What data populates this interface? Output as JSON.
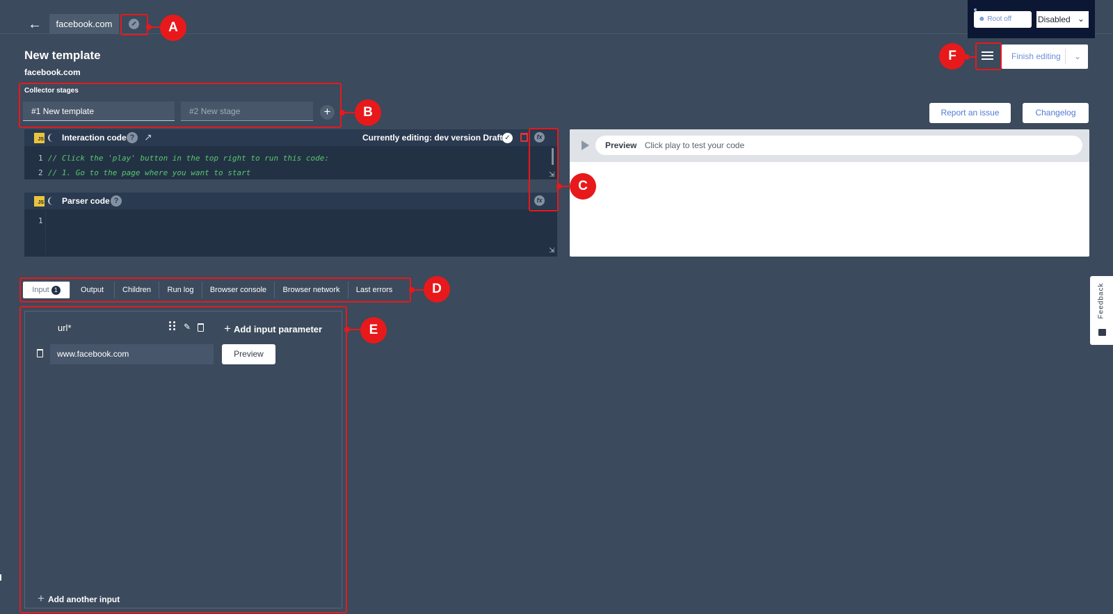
{
  "header": {
    "back_icon": "arrow-left-icon",
    "domain_tab": "facebook.com",
    "root_toggle_label": "Root off",
    "mode_select": "Disabled"
  },
  "template": {
    "title": "New template",
    "subtitle": "facebook.com",
    "finish_label": "Finish editing"
  },
  "stages": {
    "label": "Collector stages",
    "items": [
      {
        "num": "#1",
        "name": "New template"
      },
      {
        "num": "#2",
        "name": "New stage"
      }
    ]
  },
  "actions": {
    "report": "Report an issue",
    "changelog": "Changelog"
  },
  "interaction_panel": {
    "title": "Interaction code",
    "editing_status": "Currently editing: dev version Draft",
    "lines": [
      {
        "n": "1",
        "text": "// Click the 'play' button in the top right to run this code:"
      },
      {
        "n": "2",
        "text": "// 1. Go to the page where you want to start"
      }
    ]
  },
  "parser_panel": {
    "title": "Parser code",
    "lines": [
      {
        "n": "1",
        "text": ""
      }
    ]
  },
  "preview": {
    "label": "Preview",
    "hint": "Click play to test your code"
  },
  "tabs": [
    {
      "label": "Input",
      "badge": "1"
    },
    {
      "label": "Output"
    },
    {
      "label": "Children"
    },
    {
      "label": "Run log"
    },
    {
      "label": "Browser console"
    },
    {
      "label": "Browser network"
    },
    {
      "label": "Last errors"
    }
  ],
  "input": {
    "param_name": "url*",
    "add_param_label": "Add input parameter",
    "url_value": "www.facebook.com",
    "preview_button": "Preview",
    "add_another_label": "Add another input"
  },
  "feedback_label": "Feedback",
  "annotations": [
    "A",
    "B",
    "C",
    "D",
    "E",
    "F"
  ],
  "colors": {
    "background": "#3b4a5c",
    "panel": "#233145",
    "annotation_red": "#e8191b",
    "link_blue": "#4f7ad6",
    "code_comment_green": "#57c86c"
  }
}
